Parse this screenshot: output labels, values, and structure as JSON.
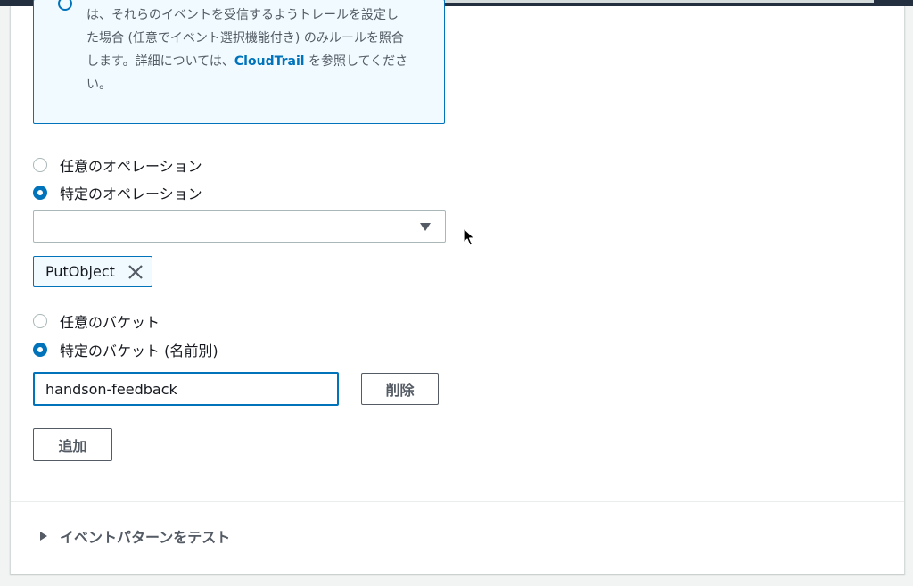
{
  "info": {
    "line1": "は、それらのイベントを受信するようトレールを設定し",
    "line2": "た場合 (任意でイベント選択機能付き) のみルールを照合",
    "line3_pre": "します。詳細については、",
    "link_text": "CloudTrail",
    "line3_post": " を参照してくださ",
    "line4": "い。"
  },
  "operation": {
    "any_label": "任意のオペレーション",
    "specific_label": "特定のオペレーション",
    "selected": "specific",
    "select_value": "",
    "tokens": [
      "PutObject"
    ]
  },
  "bucket": {
    "any_label": "任意のバケット",
    "specific_label": "特定のバケット (名前別)",
    "selected": "specific",
    "name_value": "handson-feedback",
    "remove_label": "削除",
    "add_label": "追加"
  },
  "test_section": {
    "label": "イベントパターンをテスト"
  },
  "colors": {
    "accent": "#0073bb",
    "info_bg": "#f1faff",
    "topbar": "#232f3e"
  }
}
